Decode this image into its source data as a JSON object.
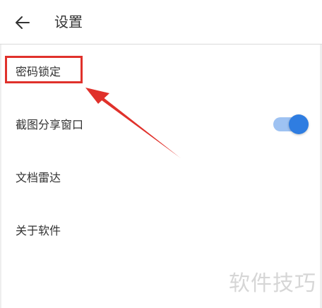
{
  "header": {
    "title": "设置",
    "back_icon": "arrow-left-icon"
  },
  "settings": {
    "items": [
      {
        "label": "密码锁定"
      },
      {
        "label": "截图分享窗口",
        "toggle_on": true
      },
      {
        "label": "文档雷达"
      },
      {
        "label": "关于软件"
      }
    ]
  },
  "annotation": {
    "highlight_color": "#e0312b"
  },
  "toggle": {
    "track_color": "#9ec2f2",
    "thumb_color": "#2f7de1"
  },
  "watermark": {
    "text": "软件技巧"
  }
}
